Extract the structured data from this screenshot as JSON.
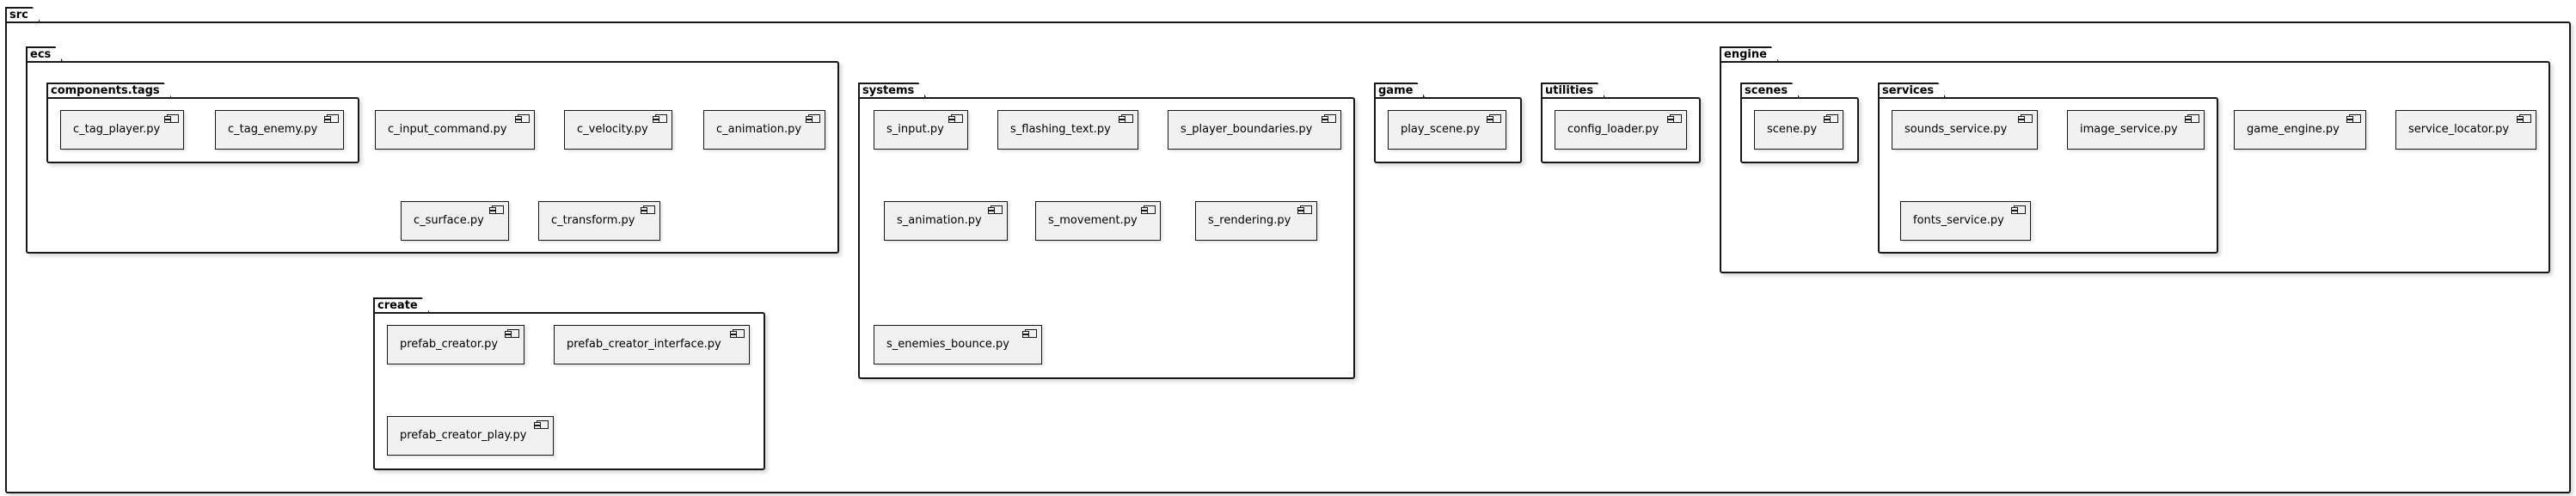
{
  "packages": {
    "src": "src",
    "ecs": "ecs",
    "components_tags": "components.tags",
    "systems": "systems",
    "game": "game",
    "utilities": "utilities",
    "engine": "engine",
    "scenes": "scenes",
    "services": "services",
    "create": "create"
  },
  "components": {
    "c_tag_player": "c_tag_player.py",
    "c_tag_enemy": "c_tag_enemy.py",
    "c_input_command": "c_input_command.py",
    "c_velocity": "c_velocity.py",
    "c_animation": "c_animation.py",
    "c_surface": "c_surface.py",
    "c_transform": "c_transform.py",
    "s_input": "s_input.py",
    "s_flashing_text": "s_flashing_text.py",
    "s_player_boundaries": "s_player_boundaries.py",
    "s_animation": "s_animation.py",
    "s_movement": "s_movement.py",
    "s_rendering": "s_rendering.py",
    "s_enemies_bounce": "s_enemies_bounce.py",
    "play_scene": "play_scene.py",
    "config_loader": "config_loader.py",
    "scene": "scene.py",
    "sounds_service": "sounds_service.py",
    "image_service": "image_service.py",
    "fonts_service": "fonts_service.py",
    "game_engine": "game_engine.py",
    "service_locator": "service_locator.py",
    "prefab_creator": "prefab_creator.py",
    "prefab_creator_interface": "prefab_creator_interface.py",
    "prefab_creator_play": "prefab_creator_play.py"
  }
}
